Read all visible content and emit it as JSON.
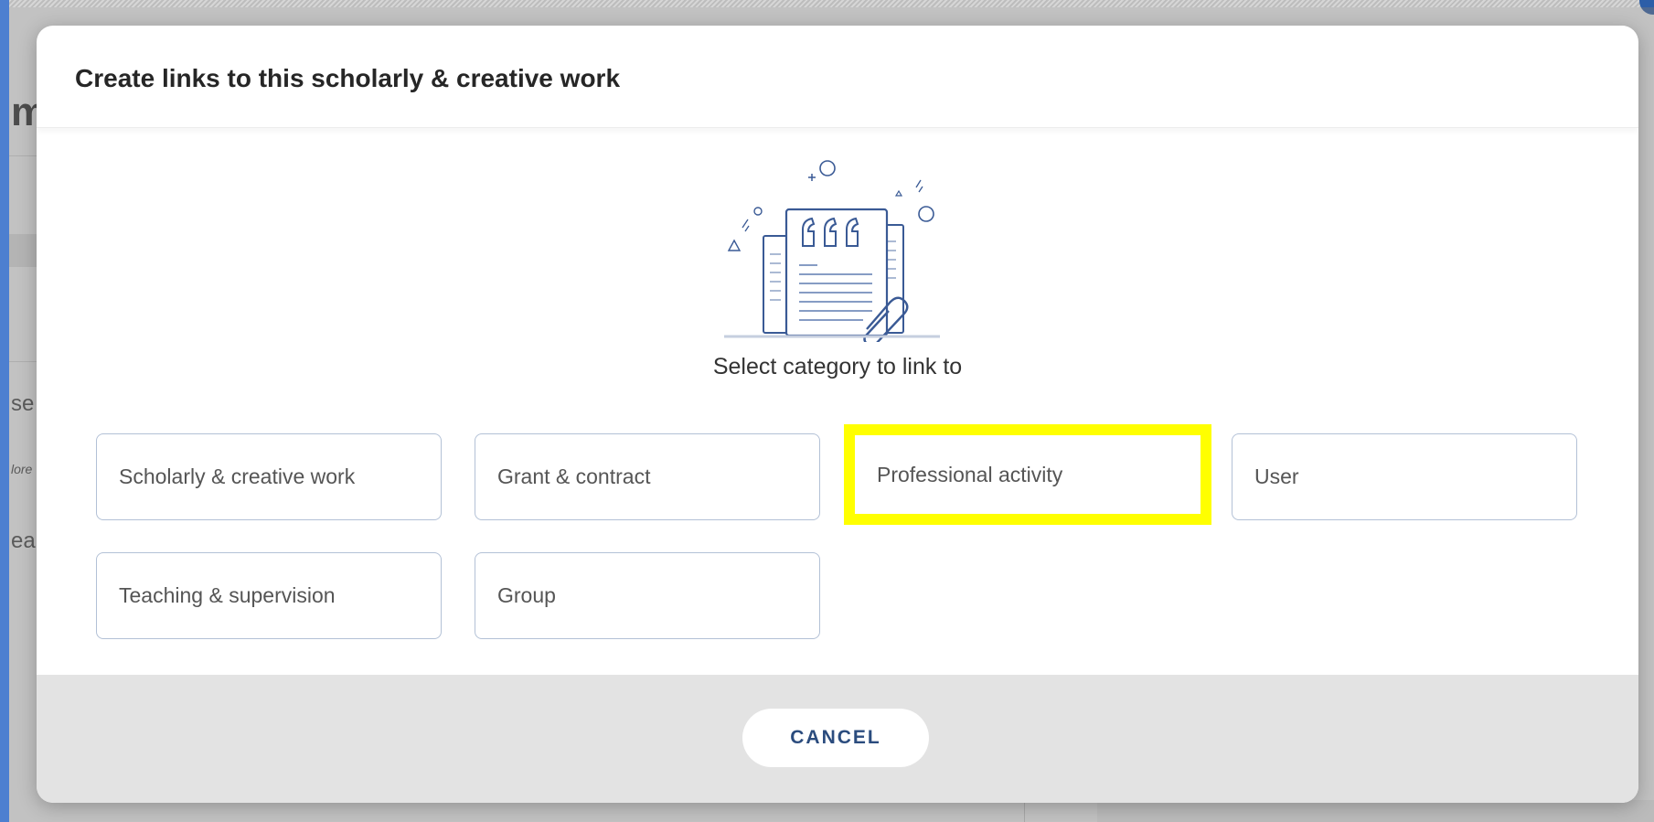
{
  "background": {
    "title_fragment": "m",
    "text_fragments": [
      "se",
      "lore",
      "ea"
    ]
  },
  "modal": {
    "title": "Create links to this scholarly & creative work",
    "illustration_icon": "document-quote-paperclip-icon",
    "prompt": "Select category to link to",
    "categories": [
      {
        "label": "Scholarly & creative work"
      },
      {
        "label": "Grant & contract"
      },
      {
        "label": "Professional activity",
        "highlighted": true
      },
      {
        "label": "User"
      },
      {
        "label": "Teaching & supervision"
      },
      {
        "label": "Group"
      }
    ],
    "cancel_label": "CANCEL"
  },
  "colors": {
    "highlight": "#ffff00",
    "cancel_text": "#2b4c7e",
    "button_border": "#b3c1d6",
    "footer_bg": "#e3e3e3"
  }
}
